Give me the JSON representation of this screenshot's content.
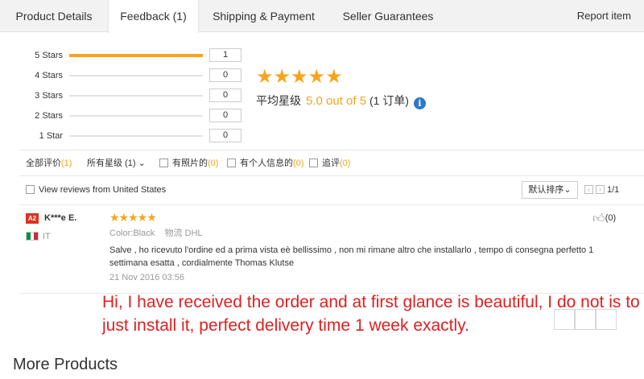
{
  "tabs": [
    {
      "label": "Product Details"
    },
    {
      "label": "Feedback (1)"
    },
    {
      "label": "Shipping & Payment"
    },
    {
      "label": "Seller Guarantees"
    }
  ],
  "report_item": "Report item",
  "rating_distribution": [
    {
      "label": "5 Stars",
      "count": "1",
      "fraction": 1.0
    },
    {
      "label": "4 Stars",
      "count": "0",
      "fraction": 0
    },
    {
      "label": "3 Stars",
      "count": "0",
      "fraction": 0
    },
    {
      "label": "2 Stars",
      "count": "0",
      "fraction": 0
    },
    {
      "label": "1 Star",
      "count": "0",
      "fraction": 0
    }
  ],
  "summary": {
    "stars": "★★★★★",
    "avg_label": "平均星级",
    "score": "5.0 out of 5",
    "orders": "(1 订单)",
    "info": "i"
  },
  "filters": {
    "all": "全部评价",
    "all_count": "(1)",
    "stars": "所有星级 (1)",
    "photos": "有照片的",
    "photos_count": "(0)",
    "personal": "有个人信息的",
    "personal_count": "(0)",
    "followup": "追评",
    "followup_count": "(0)"
  },
  "view_us": "View reviews from United States",
  "sort": "默认排序",
  "pager": {
    "text": "1/1",
    "prev": "‹",
    "next": "›"
  },
  "review": {
    "badge": "A2",
    "name": "K***e E.",
    "country": "IT",
    "stars": "★★★★★",
    "color_key": "Color:",
    "color_val": "Black",
    "ship_key": "物流",
    "ship_val": "DHL",
    "text": "Salve , ho ricevuto l'ordine ed a prima vista eè bellissimo , non mi rimane altro che installarlo , tempo di consegna perfetto 1 settimana esatta , cordialmente Thomas Klutse",
    "date": "21 Nov 2016 03:56",
    "likes": "(0)"
  },
  "translation": "Hi, I have received the order and at first glance is beautiful, I do not is to just install it, perfect delivery time 1 week exactly.",
  "more_products": "More Products",
  "colors": {
    "accent": "#f7a41c",
    "info": "#2a79c9",
    "badge": "#e0301e",
    "translation": "#e02020"
  }
}
